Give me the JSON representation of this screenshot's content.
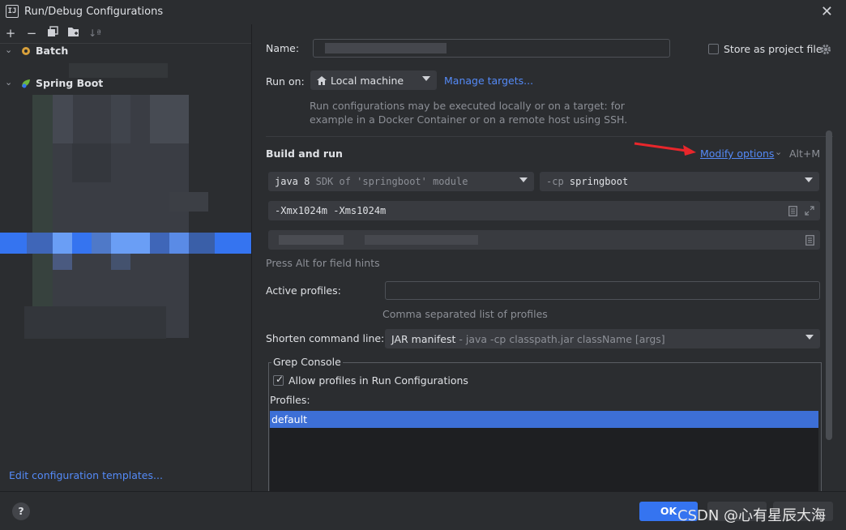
{
  "window": {
    "title": "Run/Debug Configurations",
    "app_icon": "IJ"
  },
  "sidebar": {
    "tree": [
      {
        "label": "Batch",
        "icon": "batch-icon"
      },
      {
        "label": "Spring Boot",
        "icon": "spring-boot-icon"
      }
    ],
    "edit_templates_link": "Edit configuration templates..."
  },
  "form": {
    "name_label": "Name:",
    "store_label": "Store as project file",
    "run_on_label": "Run on:",
    "run_on_value": "Local machine",
    "manage_targets": "Manage targets...",
    "run_on_hint_line1": "Run configurations may be executed locally or on a target: for",
    "run_on_hint_line2": "example in a Docker Container or on a remote host using SSH.",
    "build_run_title": "Build and run",
    "modify_options": "Modify options",
    "modify_shortcut": "Alt+M",
    "jdk_value": "java 8",
    "jdk_hint": "SDK of 'springboot' module",
    "cp_prefix": "-cp",
    "cp_value": "springboot",
    "vm_options": "-Xmx1024m -Xms1024m",
    "field_hints": "Press Alt for field hints",
    "active_profiles_label": "Active profiles:",
    "active_profiles_hint": "Comma separated list of profiles",
    "shorten_label": "Shorten command line:",
    "shorten_value": "JAR manifest",
    "shorten_hint": "- java -cp classpath.jar className [args]",
    "grep_console_title": "Grep Console",
    "allow_profiles_label": "Allow profiles in Run Configurations",
    "profiles_label": "Profiles:",
    "profiles": [
      "default"
    ]
  },
  "footer": {
    "help": "?",
    "ok": "OK",
    "watermark": "CSDN @心有星辰大海"
  },
  "colors": {
    "accent": "#3574f0",
    "link": "#548af7",
    "background": "#2b2d30",
    "arrow": "#e8262b"
  }
}
